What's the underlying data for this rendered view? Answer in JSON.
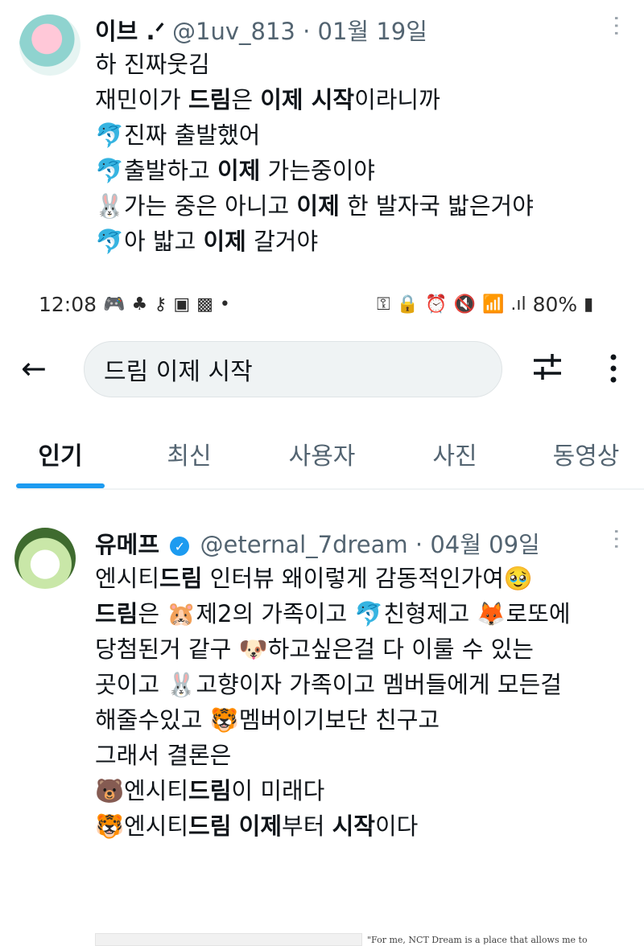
{
  "tweet1": {
    "name": "이브 .ᐟ",
    "handle": "@1uv_813",
    "dot": "·",
    "date": "01월 19일",
    "lines": [
      {
        "emoji": "",
        "parts": [
          {
            "t": "하 진짜웃김",
            "b": false
          }
        ]
      },
      {
        "emoji": "",
        "parts": [
          {
            "t": "재민이가 ",
            "b": false
          },
          {
            "t": "드림",
            "b": true
          },
          {
            "t": "은 ",
            "b": false
          },
          {
            "t": "이제 시작",
            "b": true
          },
          {
            "t": "이라니까",
            "b": false
          }
        ]
      },
      {
        "emoji": "🐬",
        "parts": [
          {
            "t": "진짜 출발했어",
            "b": false
          }
        ]
      },
      {
        "emoji": "🐬",
        "parts": [
          {
            "t": "출발하고 ",
            "b": false
          },
          {
            "t": "이제",
            "b": true
          },
          {
            "t": " 가는중이야",
            "b": false
          }
        ]
      },
      {
        "emoji": "🐰",
        "parts": [
          {
            "t": "가는 중은 아니고 ",
            "b": false
          },
          {
            "t": "이제",
            "b": true
          },
          {
            "t": " 한 발자국 밟은거야",
            "b": false
          }
        ]
      },
      {
        "emoji": "🐬",
        "parts": [
          {
            "t": "아 밟고 ",
            "b": false
          },
          {
            "t": "이제",
            "b": true
          },
          {
            "t": " 갈거야",
            "b": false
          }
        ]
      }
    ]
  },
  "statusbar": {
    "time": "12:08",
    "battery": "80%"
  },
  "search": {
    "query": "드림 이제 시작"
  },
  "tabs": [
    "인기",
    "최신",
    "사용자",
    "사진",
    "동영상"
  ],
  "tweet2": {
    "name": "유메프",
    "handle": "@eternal_7dream",
    "dot": "·",
    "date": "04월 09일",
    "lines": [
      {
        "emoji": "",
        "parts": [
          {
            "t": "엔시티",
            "b": false
          },
          {
            "t": "드림",
            "b": true
          },
          {
            "t": " 인터뷰 왜이렇게 감동적인가여🥹",
            "b": false
          }
        ]
      },
      {
        "emoji": "",
        "parts": [
          {
            "t": " ",
            "b": false
          }
        ]
      },
      {
        "emoji": "",
        "parts": [
          {
            "t": "드림",
            "b": true
          },
          {
            "t": "은 🐹제2의 가족이고 🐬친형제고 🦊로또에",
            "b": false
          }
        ]
      },
      {
        "emoji": "",
        "parts": [
          {
            "t": "당첨된거 같구 🐶하고싶은걸 다 이룰 수 있는",
            "b": false
          }
        ]
      },
      {
        "emoji": "",
        "parts": [
          {
            "t": "곳이고 🐰고향이자 가족이고 멤버들에게 모든걸",
            "b": false
          }
        ]
      },
      {
        "emoji": "",
        "parts": [
          {
            "t": "해줄수있고 🐯멤버이기보단 친구고",
            "b": false
          }
        ]
      },
      {
        "emoji": "",
        "parts": [
          {
            "t": " ",
            "b": false
          }
        ]
      },
      {
        "emoji": "",
        "parts": [
          {
            "t": "그래서 결론은",
            "b": false
          }
        ]
      },
      {
        "emoji": "🐻",
        "parts": [
          {
            "t": "엔시티",
            "b": false
          },
          {
            "t": "드림",
            "b": true
          },
          {
            "t": "이 미래다",
            "b": false
          }
        ]
      },
      {
        "emoji": "🐯",
        "parts": [
          {
            "t": "엔시티",
            "b": false
          },
          {
            "t": "드림",
            "b": true
          },
          {
            "t": " ",
            "b": false
          },
          {
            "t": "이제",
            "b": true
          },
          {
            "t": "부터 ",
            "b": false
          },
          {
            "t": "시작",
            "b": true
          },
          {
            "t": "이다",
            "b": false
          }
        ]
      }
    ],
    "preview_text": "\"For me, NCT Dream is a place that allows me to"
  },
  "colors": {
    "accent": "#1d9bf0",
    "text": "#0f1419",
    "muted": "#536471"
  }
}
